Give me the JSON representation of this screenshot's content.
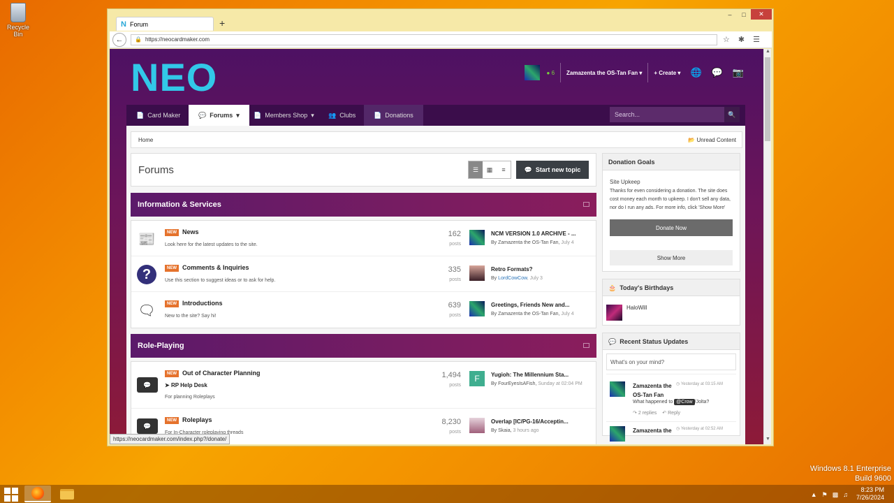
{
  "desktop": {
    "recycle_bin": "Recycle Bin",
    "os_name": "Windows 8.1 Enterprise",
    "os_build": "Build 9600",
    "clock_time": "8:23 PM",
    "clock_date": "7/26/2024"
  },
  "browser": {
    "tab_title": "Forum",
    "url": "https://neocardmaker.com",
    "status_url": "https://neocardmaker.com/index.php?/donate/"
  },
  "site": {
    "logo": "NEO",
    "user": {
      "rep": "6",
      "name": "Zamazenta the OS-Tan Fan",
      "create": "Create"
    },
    "nav": {
      "card_maker": "Card Maker",
      "forums": "Forums",
      "members_shop": "Members Shop",
      "clubs": "Clubs",
      "donations": "Donations",
      "search_placeholder": "Search..."
    },
    "breadcrumb": {
      "home": "Home",
      "unread": "Unread Content"
    },
    "page": {
      "title": "Forums",
      "start_topic": "Start new topic"
    },
    "categories": [
      {
        "name": "Information & Services",
        "forums": [
          {
            "badge": "NEW",
            "name": "News",
            "desc": "Look here for the latest updates to the site.",
            "count": "162",
            "count_label": "posts",
            "last_title": "NCM VERSION 1.0 ARCHIVE - ...",
            "last_by": "By Zamazenta the OS-Tan Fan,",
            "last_date": "July 4"
          },
          {
            "badge": "NEW",
            "name": "Comments & Inquiries",
            "desc": "Use this section to suggest ideas or to ask for help.",
            "count": "335",
            "count_label": "posts",
            "last_title": "Retro Formats?",
            "last_by_prefix": "By",
            "last_by_link": "LordCowCow",
            "last_date": ", July 3"
          },
          {
            "badge": "NEW",
            "name": "Introductions",
            "desc": "New to the site? Say hi!",
            "count": "639",
            "count_label": "posts",
            "last_title": "Greetings, Friends New and...",
            "last_by": "By Zamazenta the OS-Tan Fan,",
            "last_date": "July 4"
          }
        ]
      },
      {
        "name": "Role-Playing",
        "forums": [
          {
            "badge": "NEW",
            "name": "Out of Character Planning",
            "subforum": "RP Help Desk",
            "desc": "For planning Roleplays",
            "count": "1,494",
            "count_label": "posts",
            "avatar_letter": "F",
            "last_title": "Yugioh: The Millennium Sta...",
            "last_by": "By FourEyesIsAFish,",
            "last_date": "Sunday at 02:04 PM"
          },
          {
            "badge": "NEW",
            "name": "Roleplays",
            "desc": "For In-Character roleplaying threads",
            "count": "8,230",
            "count_label": "posts",
            "last_title": "Overlap [IC/PG-16/Acceptin...",
            "last_by": "By Skaia,",
            "last_date": "3 hours ago"
          }
        ]
      }
    ],
    "sidebar": {
      "donation": {
        "title": "Donation Goals",
        "name": "Site Upkeep",
        "text": "Thanks for even considering a donation. The site does cost money each month to upkeep. I don't sell any data, nor do I run any ads. For more info, click 'Show More'",
        "donate_btn": "Donate Now",
        "show_more": "Show More"
      },
      "birthdays": {
        "title": "Today's Birthdays",
        "user": "HaloWill"
      },
      "status": {
        "title": "Recent Status Updates",
        "placeholder": "What's on your mind?",
        "item_name": "Zamazenta the OS-Tan Fan",
        "item_time": "Yesterday at 03:15 AM",
        "item_text_before": "What happened to",
        "item_mention": "@Crow",
        "item_text_after": "/Jolta?",
        "replies": "2 replies",
        "reply": "Reply",
        "item2_name": "Zamazenta the",
        "item2_time": "Yesterday at 02:52 AM"
      }
    }
  }
}
